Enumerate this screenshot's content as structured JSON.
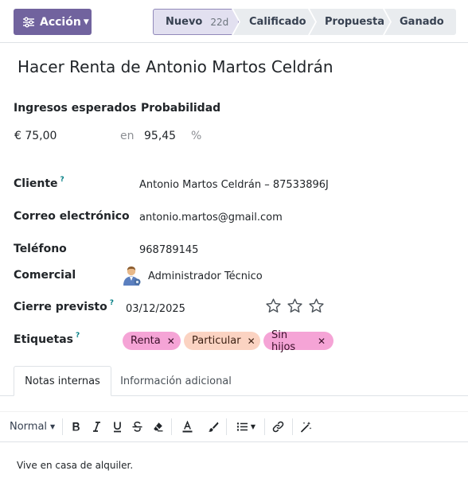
{
  "topbar": {
    "action_label": "Acción",
    "stages": [
      {
        "label": "Nuevo",
        "days": "22d"
      },
      {
        "label": "Calificado"
      },
      {
        "label": "Propuesta"
      },
      {
        "label": "Ganado"
      }
    ]
  },
  "record": {
    "title": "Hacer Renta de Antonio Martos Celdrán",
    "expected_revenue_label": "Ingresos esperados",
    "probability_label": "Probabilidad",
    "expected_revenue": "€ 75,00",
    "in_label": "en",
    "probability": "95,45",
    "percent": "%",
    "customer_label": "Cliente",
    "customer": "Antonio Martos Celdrán – 87533896J",
    "email_label": "Correo electrónico",
    "email": "antonio.martos@gmail.com",
    "phone_label": "Teléfono",
    "phone": "968789145",
    "salesperson_label": "Comercial",
    "salesperson": "Administrador Técnico",
    "deadline_label": "Cierre previsto",
    "deadline": "03/12/2025",
    "priority_stars": 0,
    "priority_max": 3,
    "tags_label": "Etiquetas",
    "help_mark": "?",
    "tags": [
      "Renta",
      "Particular",
      "Sin hijos"
    ]
  },
  "tabs": [
    "Notas internas",
    "Información adicional"
  ],
  "editor": {
    "style_label": "Normal",
    "note_text": "Vive en casa de alquiler."
  },
  "colors": {
    "accent": "#71639e",
    "tag_pink": "#f5a4d6",
    "tag_peach": "#fbd3c2",
    "help": "#017e84"
  }
}
